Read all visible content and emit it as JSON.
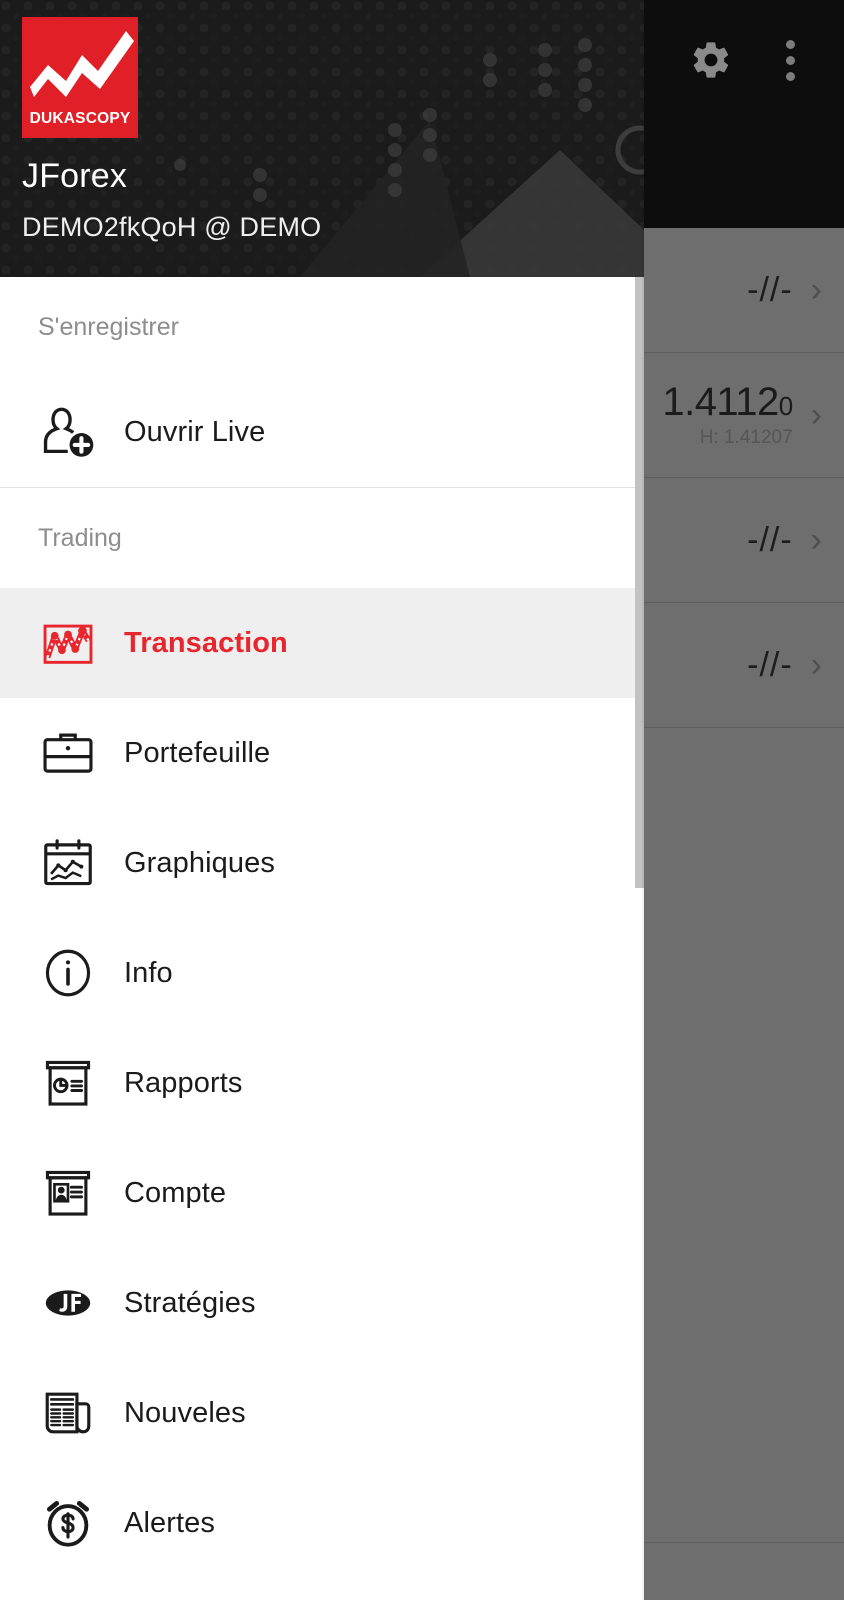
{
  "app": {
    "title": "JForex",
    "account": "DEMO2fkQoH @ DEMO",
    "brand": "DUKASCOPY",
    "accent_red": "#e8262d",
    "logo_red": "#e01f26"
  },
  "appbar": {
    "gear_icon": "gear-icon",
    "overflow_icon": "overflow-menu-icon"
  },
  "background_list": {
    "rows": [
      {
        "value": "-//-",
        "high": "",
        "chevron": "›"
      },
      {
        "value": "1.4112",
        "value_small": "0",
        "high": "H: 1.41207",
        "chevron": "›"
      },
      {
        "value": "-//-",
        "high": "",
        "chevron": "›"
      },
      {
        "value": "-//-",
        "high": "",
        "chevron": "›"
      }
    ]
  },
  "bottom_bar": {
    "dots_icon": "three-circles-icon"
  },
  "drawer": {
    "sections": [
      {
        "label": "S'enregistrer",
        "items": [
          {
            "label": "Ouvrir Live",
            "icon": "user-add-icon",
            "active": false
          }
        ]
      },
      {
        "label": "Trading",
        "items": [
          {
            "label": "Transaction",
            "icon": "chart-red-icon",
            "active": true
          },
          {
            "label": "Portefeuille",
            "icon": "briefcase-icon",
            "active": false
          },
          {
            "label": "Graphiques",
            "icon": "calendar-chart-icon",
            "active": false
          },
          {
            "label": "Info",
            "icon": "info-circle-icon",
            "active": false
          },
          {
            "label": "Rapports",
            "icon": "report-board-icon",
            "active": false
          },
          {
            "label": "Compte",
            "icon": "account-card-icon",
            "active": false
          },
          {
            "label": "Stratégies",
            "icon": "jf-logo-icon",
            "active": false
          },
          {
            "label": "Nouveles",
            "icon": "newspaper-icon",
            "active": false
          },
          {
            "label": "Alertes",
            "icon": "alarm-dollar-icon",
            "active": false
          }
        ]
      }
    ]
  }
}
